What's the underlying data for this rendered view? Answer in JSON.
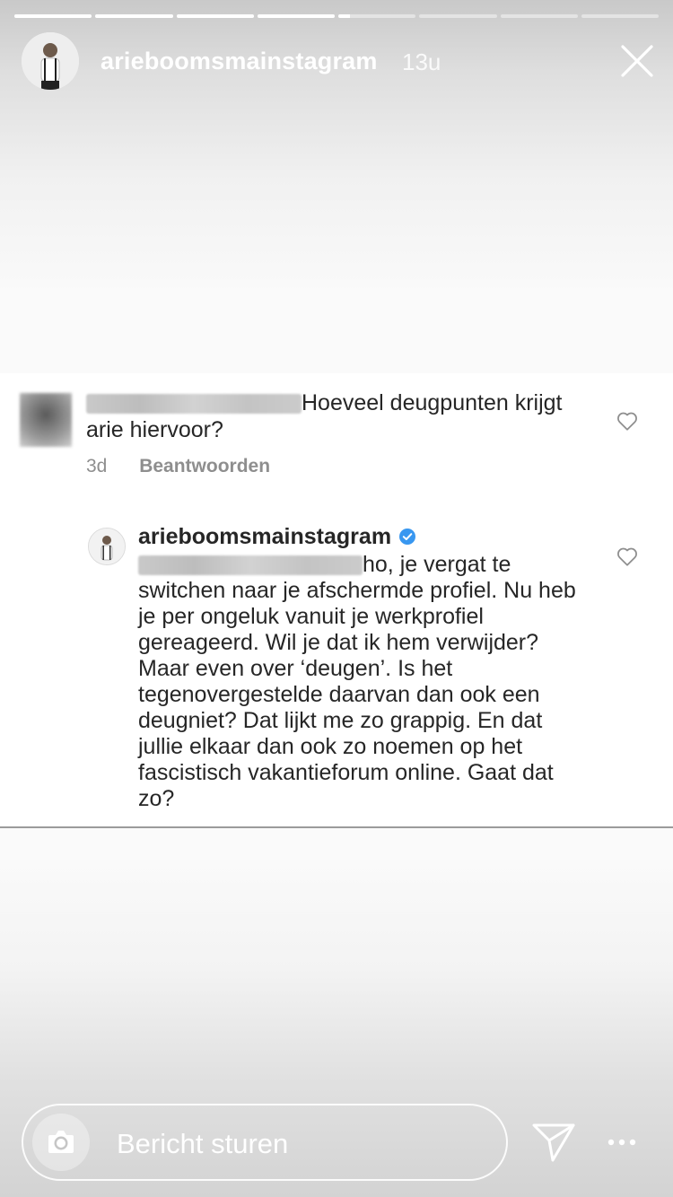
{
  "story": {
    "username": "arieboomsmainstagram",
    "time_ago": "13u",
    "segments": [
      1,
      1,
      1,
      1,
      0.15,
      0,
      0,
      0
    ]
  },
  "comment": {
    "text": "Hoeveel deugpunten krijgt arie hiervoor?",
    "age": "3d",
    "reply_label": "Beantwoorden"
  },
  "reply": {
    "username": "arieboomsmainstagram",
    "text": "ho, je vergat te switchen naar je afschermde profiel. Nu heb je per ongeluk vanuit je werkprofiel gereageerd. Wil je dat ik hem verwijder? Maar even over ‘deugen’. Is het tegenovergestelde daarvan dan ook een deugniet? Dat lijkt me zo grappig. En dat jullie elkaar dan ook zo noemen op het fascistisch vakantieforum online. Gaat dat zo?"
  },
  "footer": {
    "message_placeholder": "Bericht sturen"
  },
  "icons": {
    "close": "close-icon",
    "heart": "heart-outline-icon",
    "camera": "camera-icon",
    "send": "send-icon",
    "more": "more-icon",
    "verified": "verified-badge-icon"
  },
  "colors": {
    "verified_blue": "#3897f0",
    "text": "#262626",
    "meta_gray": "#8e8e8e"
  }
}
